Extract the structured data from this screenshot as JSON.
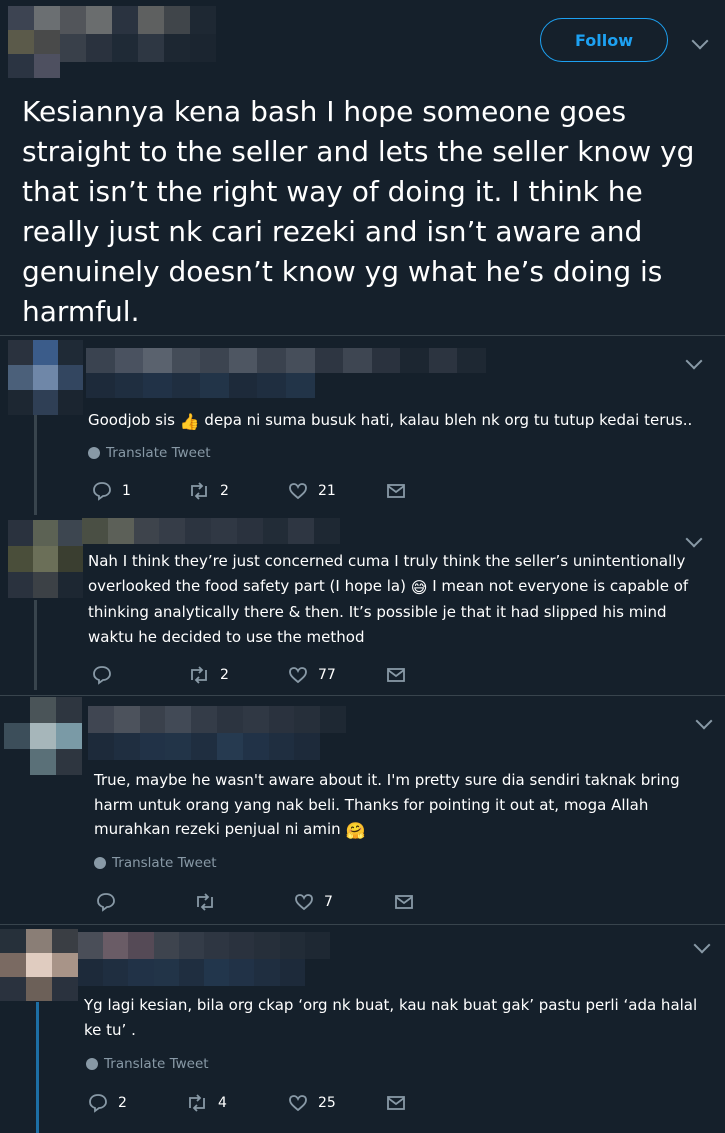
{
  "main_tweet": {
    "follow_label": "Follow",
    "text": "Kesiannya kena bash I hope someone goes straight to the seller and lets the seller know yg that isn’t the right way of doing it. I think he really just nk cari rezeki and isn’t aware and genuinely doesn’t know yg what he’s doing is harmful."
  },
  "replies": [
    {
      "text": "Goodjob sis",
      "emoji": "👍",
      "text_after": "depa ni suma busuk hati, kalau bleh nk org tu tutup kedai terus..",
      "translate": "Translate Tweet",
      "replies": "1",
      "retweets": "2",
      "likes": "21"
    },
    {
      "text_part1": "Nah I think they’re just concerned cuma I truly think the seller’s unintentionally overlooked the food safety part (I hope la)",
      "emoji": "😅",
      "text_part2": "I mean not everyone is capable of thinking analytically there & then. It’s possible je that it had slipped his mind waktu he decided to use the method",
      "retweets": "2",
      "likes": "77"
    },
    {
      "text": "True, maybe he wasn't aware about it. I'm pretty sure dia sendiri taknak  bring harm untuk orang yang nak beli. Thanks for pointing it out at, moga Allah murahkan rezeki penjual ni amin",
      "emoji": "🤗",
      "translate": "Translate Tweet",
      "likes": "7"
    },
    {
      "text": "Yg lagi kesian, bila org ckap ‘org nk buat, kau nak buat gak’  pastu perli ‘ada halal ke tu’ .",
      "translate": "Translate Tweet",
      "replies": "2",
      "retweets": "4",
      "likes": "25"
    }
  ]
}
